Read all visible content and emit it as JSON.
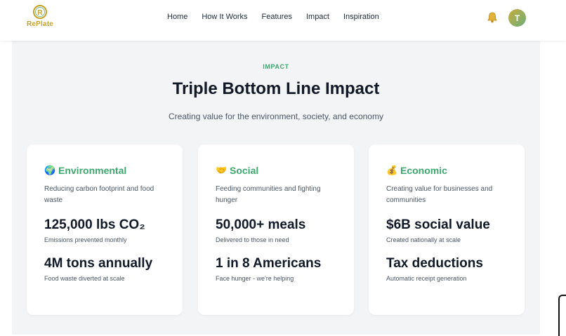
{
  "brand": {
    "name": "RePlate",
    "mark": "R"
  },
  "nav": [
    "Home",
    "How It Works",
    "Features",
    "Impact",
    "Inspiration"
  ],
  "user": {
    "initial": "T"
  },
  "section": {
    "eyebrow": "IMPACT",
    "title": "Triple Bottom Line Impact",
    "subtitle": "Creating value for the environment, society, and economy"
  },
  "cards": [
    {
      "icon": "🌍",
      "icon_name": "globe-icon",
      "title": "Environmental",
      "desc": "Reducing carbon footprint and food waste",
      "metric1": "125,000 lbs CO₂",
      "metric1_sub": "Emissions prevented monthly",
      "metric2": "4M tons annually",
      "metric2_sub": "Food waste diverted at scale"
    },
    {
      "icon": "🤝",
      "icon_name": "handshake-icon",
      "title": "Social",
      "desc": "Feeding communities and fighting hunger",
      "metric1": "50,000+ meals",
      "metric1_sub": "Delivered to those in need",
      "metric2": "1 in 8 Americans",
      "metric2_sub": "Face hunger - we're helping"
    },
    {
      "icon": "💰",
      "icon_name": "money-bag-icon",
      "title": "Economic",
      "desc": "Creating value for businesses and communities",
      "metric1": "$6B social value",
      "metric1_sub": "Created nationally at scale",
      "metric2": "Tax deductions",
      "metric2_sub": "Automatic receipt generation"
    }
  ],
  "colors": {
    "accent_green": "#3da86e",
    "brand_gold": "#c7a22b"
  }
}
